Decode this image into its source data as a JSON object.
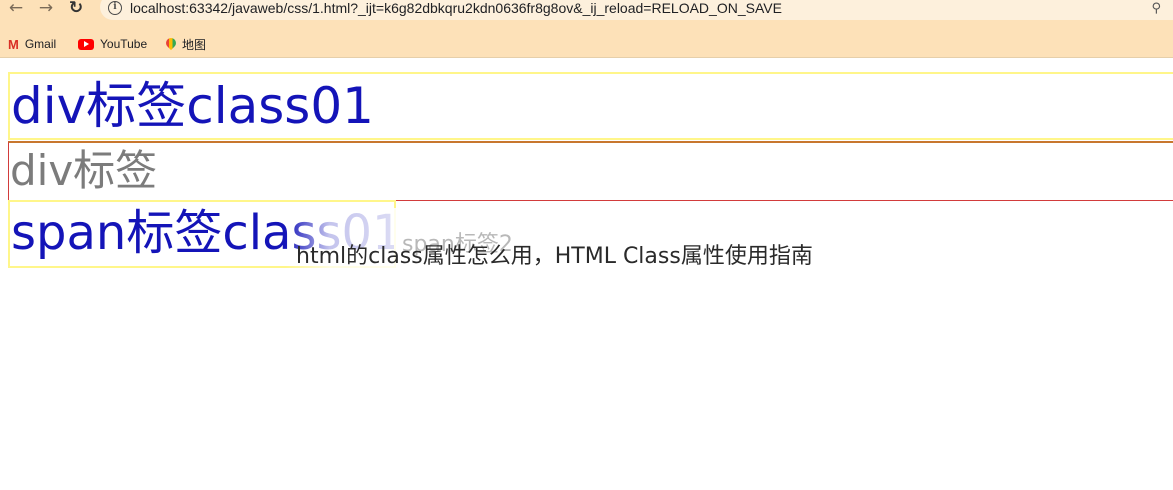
{
  "browser": {
    "back_icon": "arrow-left-icon",
    "forward_icon": "arrow-right-icon",
    "reload_icon": "reload-icon",
    "url": "localhost:63342/javaweb/css/1.html?_ijt=k6g82dbkqru2kdn0636fr8g8ov&_ij_reload=RELOAD_ON_SAVE",
    "zoom_icon": "zoom-icon"
  },
  "bookmarks": [
    {
      "label": "Gmail",
      "icon": "gmail-icon"
    },
    {
      "label": "YouTube",
      "icon": "youtube-icon"
    },
    {
      "label": "地图",
      "icon": "maps-icon"
    }
  ],
  "page": {
    "div_class01": "div标签class01",
    "div_plain": "div标签",
    "span_class01": "span标签class01",
    "span2": "span标签2",
    "caption": "html的class属性怎么用，HTML Class属性使用指南"
  },
  "colors": {
    "chrome_bg": "#fde1b8",
    "class01_text": "#1414b8",
    "class01_border": "#fff68a",
    "div_border": "#d23b3b",
    "plain_text": "#7c7c7c"
  }
}
